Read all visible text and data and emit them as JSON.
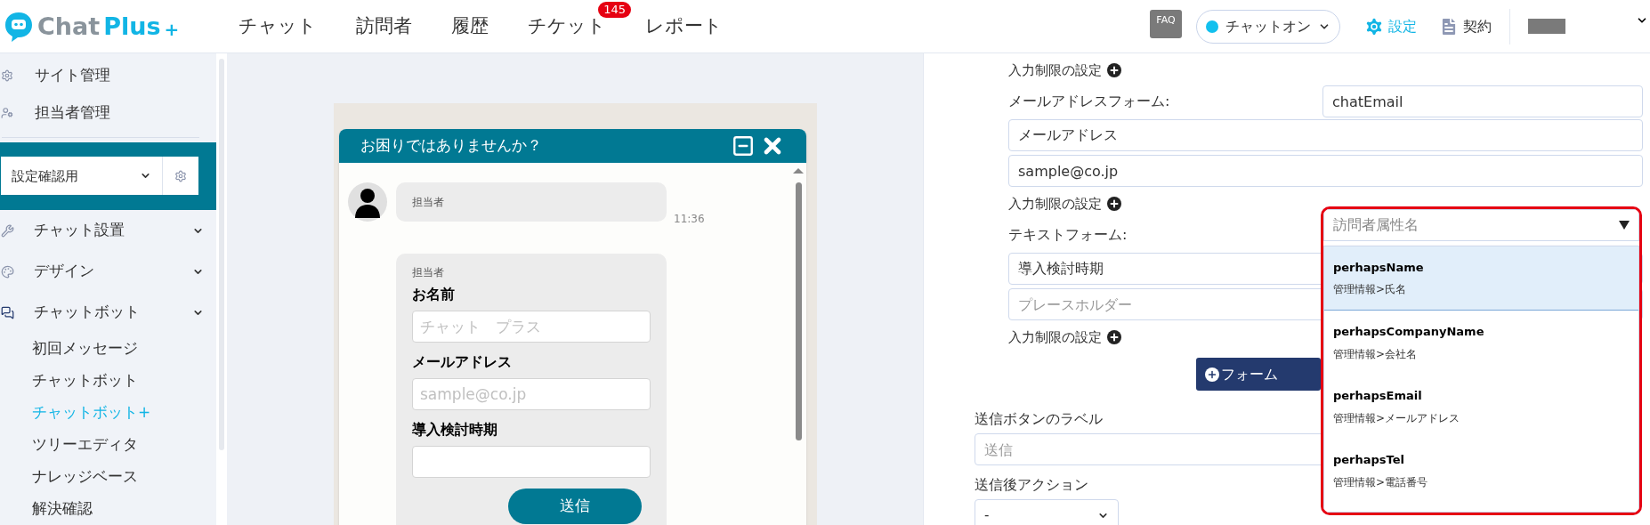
{
  "header": {
    "logo": {
      "word1": "Chat",
      "word2": "Plus",
      "mark": "+"
    },
    "nav": [
      {
        "label": "チャット"
      },
      {
        "label": "訪問者"
      },
      {
        "label": "履歴"
      },
      {
        "label": "チケット",
        "badge": "145"
      },
      {
        "label": "レポート"
      }
    ],
    "faq": "FAQ",
    "status": {
      "label": "チャットオン",
      "on": true
    },
    "settings": "設定",
    "contract": "契約"
  },
  "sidebar": {
    "top_items": [
      {
        "label": "サイト管理"
      },
      {
        "label": "担当者管理"
      }
    ],
    "site_select": "設定確認用",
    "menu": [
      {
        "label": "チャット設置"
      },
      {
        "label": "デザイン"
      },
      {
        "label": "チャットボット",
        "children": [
          {
            "label": "初回メッセージ",
            "selected": false
          },
          {
            "label": "チャットボット",
            "selected": false
          },
          {
            "label": "チャットボット+",
            "selected": true
          },
          {
            "label": "ツリーエディタ",
            "selected": false
          },
          {
            "label": "ナレッジベース",
            "selected": false
          },
          {
            "label": "解決確認",
            "selected": false
          }
        ]
      }
    ]
  },
  "preview": {
    "title": "お困りではありませんか？",
    "messages": [
      {
        "kind": "text",
        "sender": "担当者",
        "time": "11:36"
      },
      {
        "kind": "form",
        "sender": "担当者",
        "fields": [
          {
            "label": "お名前",
            "placeholder": "チャット　プラス"
          },
          {
            "label": "メールアドレス",
            "placeholder": "sample@co.jp"
          },
          {
            "label": "導入検討時期"
          }
        ],
        "submit": "送信"
      }
    ]
  },
  "editor": {
    "rows": [
      {
        "kind": "restrict",
        "label": "入力制限の設定"
      },
      {
        "kind": "form_head",
        "label": "メールアドレスフォーム:",
        "value": "chatEmail"
      },
      {
        "kind": "input",
        "value": "メールアドレス"
      },
      {
        "kind": "input",
        "value": "sample@co.jp"
      },
      {
        "kind": "restrict",
        "label": "入力制限の設定"
      },
      {
        "kind": "form_head",
        "label": "テキストフォーム:"
      },
      {
        "kind": "input",
        "value": "導入検討時期"
      },
      {
        "kind": "input",
        "placeholder": "プレースホルダー"
      },
      {
        "kind": "restrict",
        "label": "入力制限の設定"
      },
      {
        "kind": "add_button",
        "label": "フォーム"
      }
    ],
    "submit_label": {
      "label": "送信ボタンのラベル",
      "placeholder": "送信"
    },
    "after_action": {
      "label": "送信後アクション",
      "value": "-"
    },
    "attribute_dropdown": {
      "placeholder": "訪問者属性名",
      "options": [
        {
          "name": "perhapsName",
          "path": "管理情報>氏名",
          "selected": true
        },
        {
          "name": "perhapsCompanyName",
          "path": "管理情報>会社名",
          "selected": false
        },
        {
          "name": "perhapsEmail",
          "path": "管理情報>メールアドレス",
          "selected": false
        },
        {
          "name": "perhapsTel",
          "path": "管理情報>電話番号",
          "selected": false
        }
      ]
    }
  }
}
